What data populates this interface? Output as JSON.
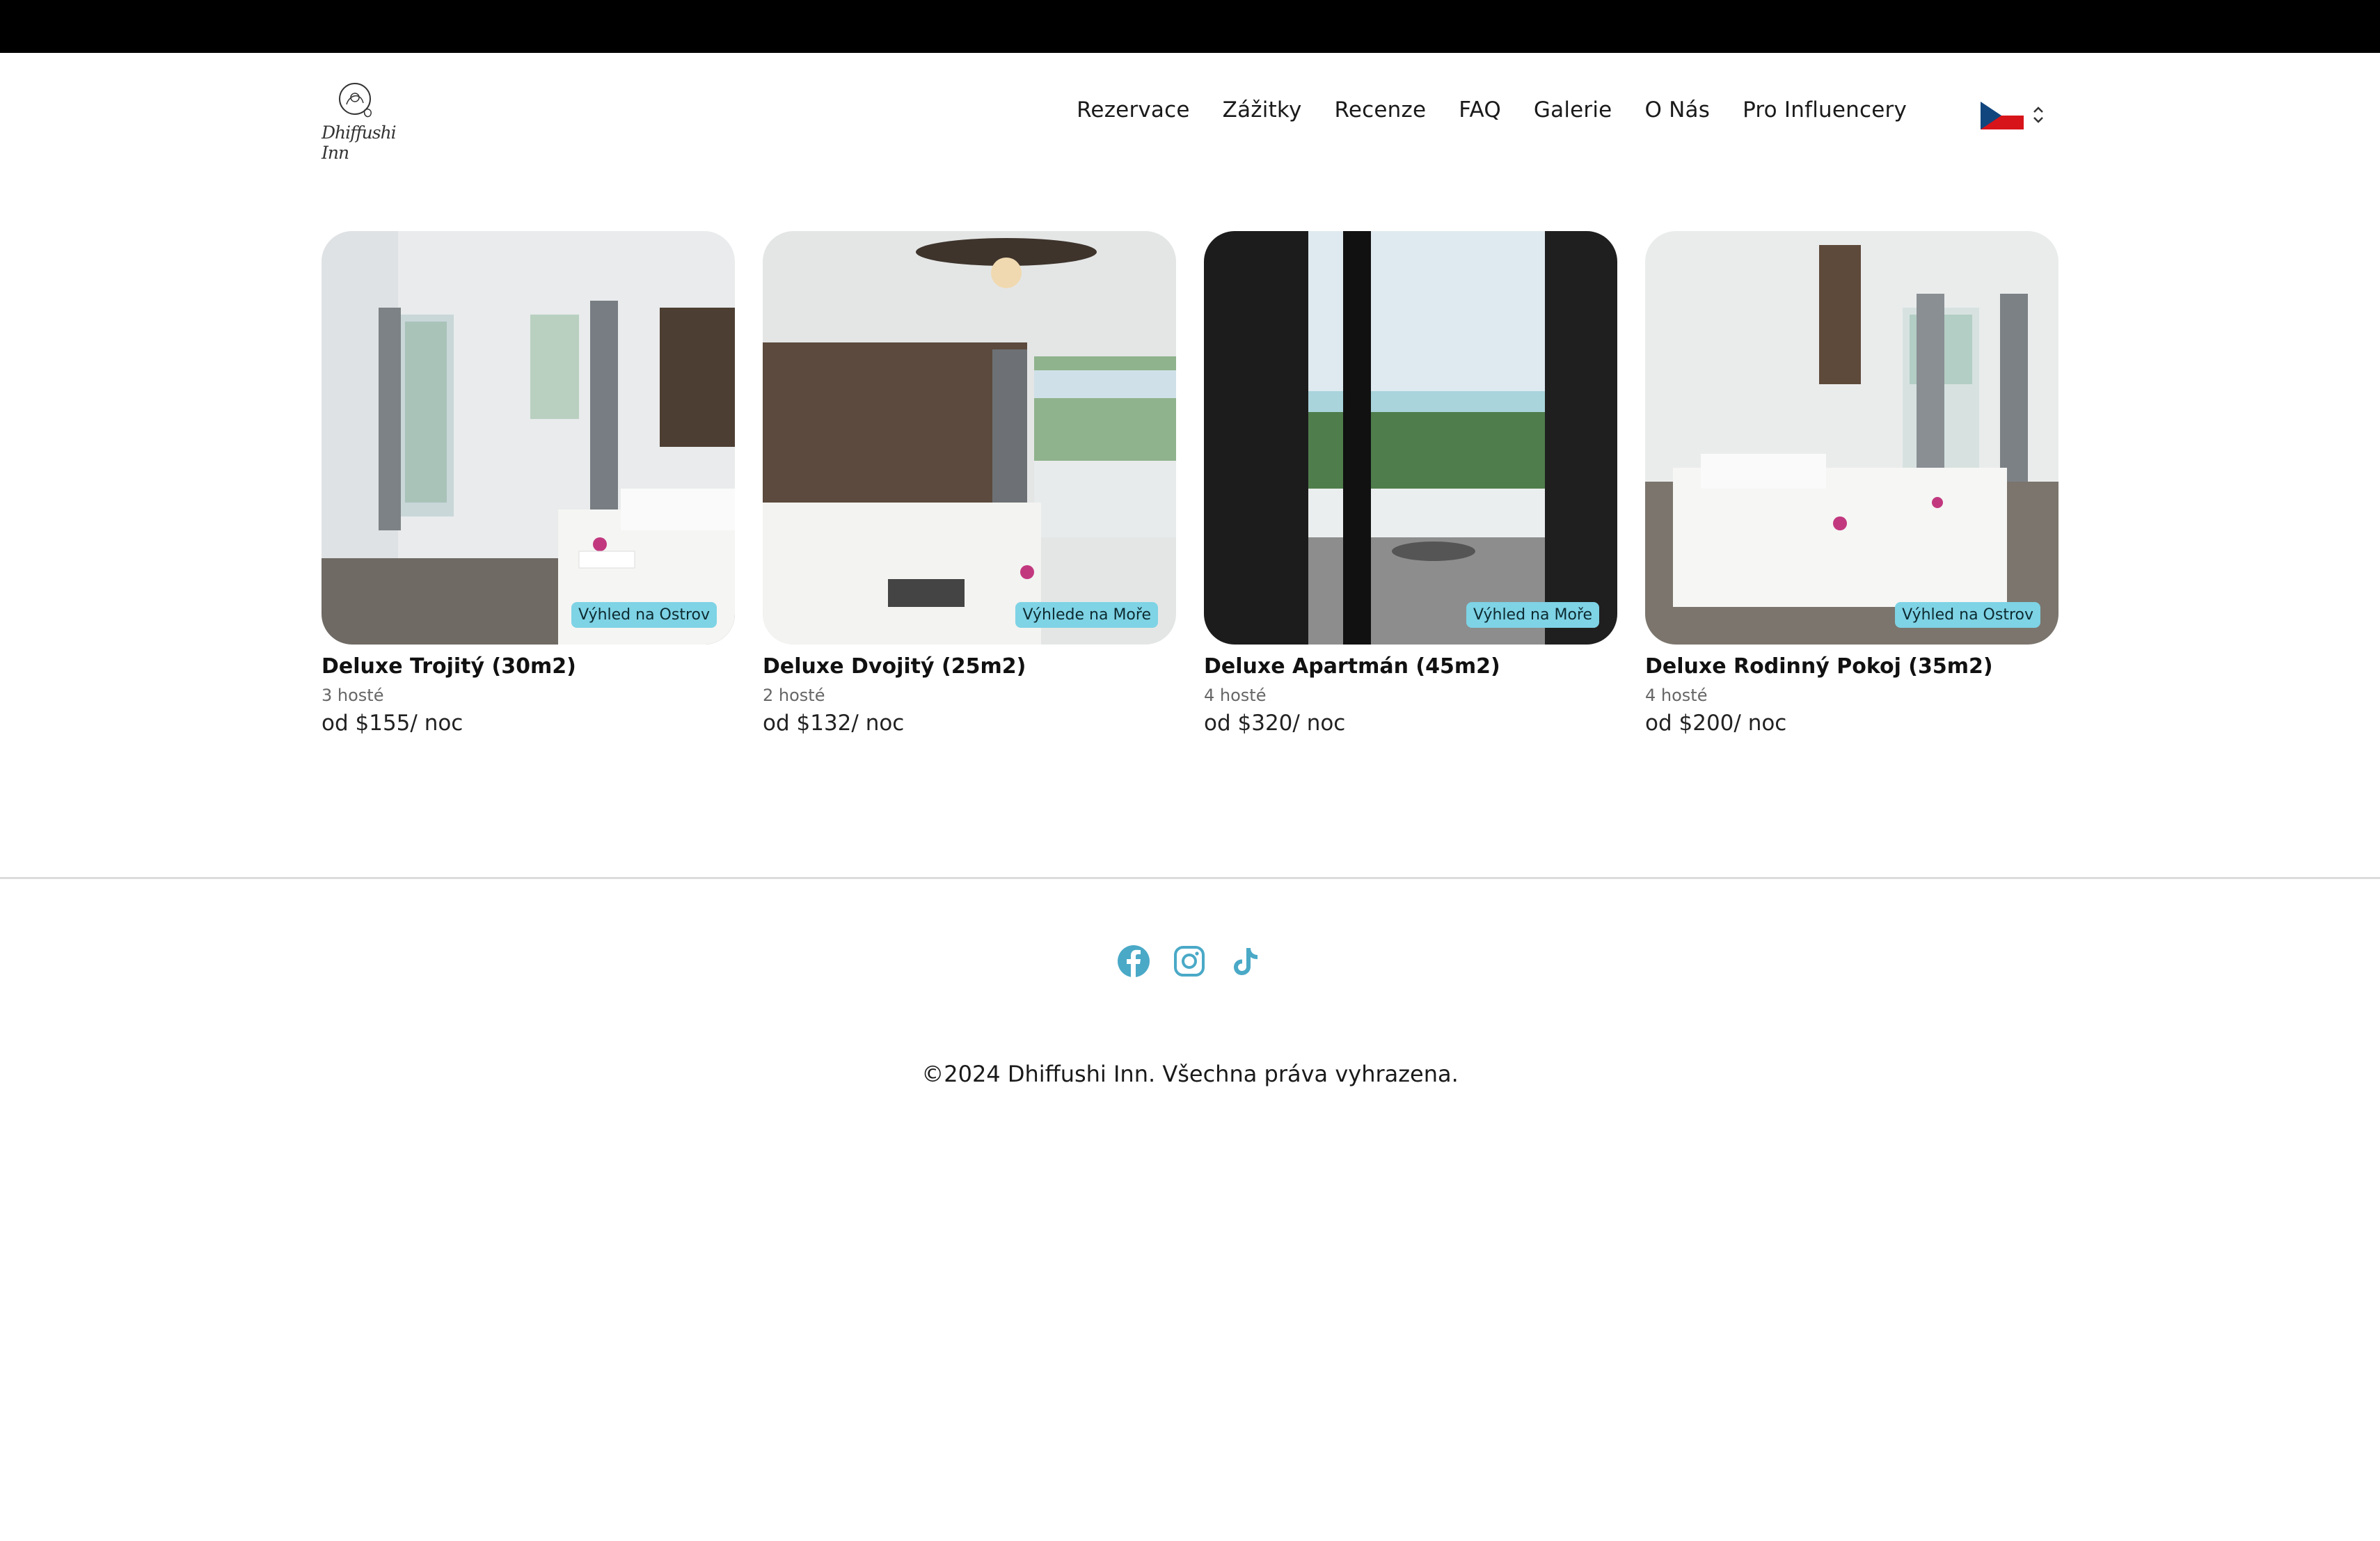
{
  "header": {
    "logo_text": "Dhiffushi Inn",
    "nav": [
      "Rezervace",
      "Zážitky",
      "Recenze",
      "FAQ",
      "Galerie",
      "O Nás",
      "Pro Influencery"
    ],
    "language": {
      "flag_icon": "czech-flag-icon",
      "selector_icon": "chevron-updown-icon"
    }
  },
  "rooms": [
    {
      "title": "Deluxe Trojitý (30m2)",
      "guests": "3 hosté",
      "price": "od $155/ noc",
      "badge": "Výhled na Ostrov"
    },
    {
      "title": "Deluxe Dvojitý (25m2)",
      "guests": "2 hosté",
      "price": "od $132/ noc",
      "badge": "Výhlede na Moře"
    },
    {
      "title": "Deluxe Apartmán (45m2)",
      "guests": "4 hosté",
      "price": "od $320/ noc",
      "badge": "Výhled na Moře"
    },
    {
      "title": "Deluxe Rodinný Pokoj (35m2)",
      "guests": "4 hosté",
      "price": "od $200/ noc",
      "badge": "Výhled na Ostrov"
    }
  ],
  "footer": {
    "social_icons": [
      "facebook-icon",
      "instagram-icon",
      "tiktok-icon"
    ],
    "social_color": "#4aa9c7",
    "copyright": "©2024 Dhiffushi Inn. Všechna práva vyhrazena."
  },
  "colors": {
    "badge": "#7ed3e5",
    "topbar": "#000000"
  }
}
